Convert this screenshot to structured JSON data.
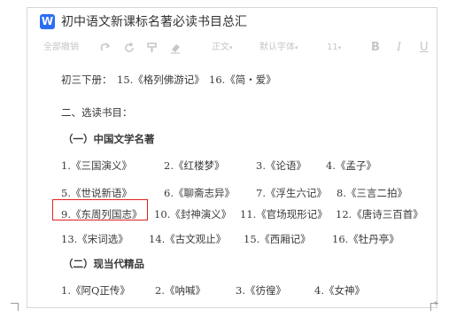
{
  "app": {
    "logo_letter": "W",
    "title": "初中语文新课标名著必读书目总汇"
  },
  "toolbar": {
    "format_painter_label": "全部撤销",
    "style_label": "正文",
    "font_label": "默认字体",
    "size_label": "11",
    "bold_label": "B",
    "italic_label": "I",
    "underline_label": "U",
    "caret": "▾"
  },
  "document": {
    "line1": {
      "prefix": "初三下册：",
      "items": [
        "15.《格列佛游记》",
        "16.《简・爱》"
      ]
    },
    "section2_title": "二、选读书目：",
    "subsection1_title": "（一）中国文学名著",
    "row1": [
      "1.《三国演义》",
      "2.《红楼梦》",
      "3.《论语》",
      "4.《孟子》"
    ],
    "row2": [
      "5.《世说新语》",
      "6.《聊斋志异》",
      "7.《浮生六记》",
      "8.《三言二拍》"
    ],
    "row3": [
      "9.《东周列国志》",
      "10.《封神演义》",
      "11.《官场现形记》",
      "12.《唐诗三百首》"
    ],
    "row4": [
      "13.《宋词选》",
      "14.《古文观止》",
      "15.《西厢记》",
      "16.《牡丹亭》"
    ],
    "subsection2_title": "（二）现当代精品",
    "row5": [
      "1.《阿Q正传》",
      "2.《呐喊》",
      "3.《彷徨》",
      "4.《女神》"
    ],
    "paragraph_mark": "↲"
  },
  "colors": {
    "accent": "#2b6ef5",
    "highlight_border": "#e02020",
    "toolbar_disabled": "#c6c6c6"
  },
  "icons": [
    "word-app-icon",
    "redo-icon",
    "refresh-icon",
    "format-brush-icon",
    "eraser-icon"
  ]
}
